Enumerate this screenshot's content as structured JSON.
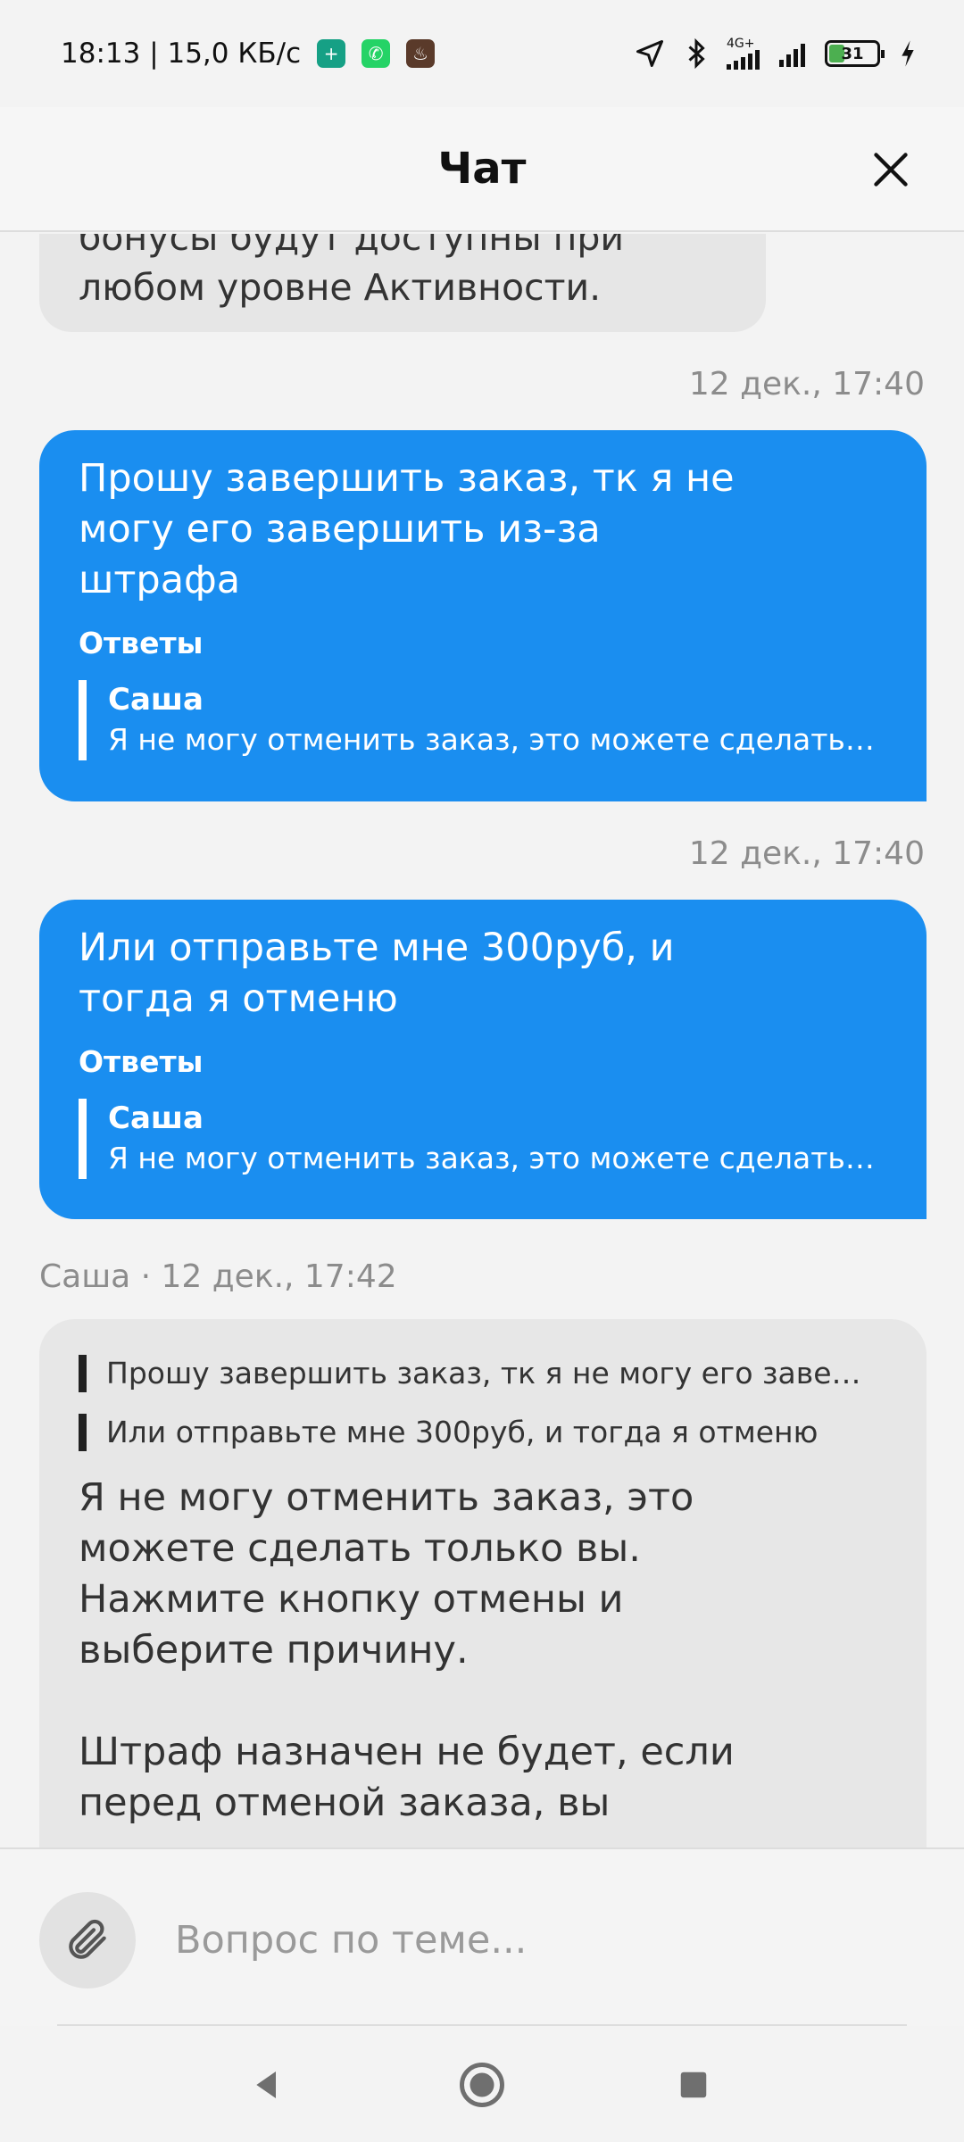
{
  "status_bar": {
    "time_speed": "18:13 | 15,0 КБ/с",
    "network_label": "4G+",
    "battery_level": "31"
  },
  "header": {
    "title": "Чат"
  },
  "chat": {
    "partial_message": {
      "line1": "бонусы будут доступны при",
      "line2": "любом уровне Активности."
    },
    "messages": [
      {
        "timestamp": "12 дек., 17:40",
        "text": "Прошу завершить заказ, тк я не могу его завершить из-за штрафа",
        "answers_label": "Ответы",
        "reply_author": "Саша",
        "reply_text": "Я не могу отменить заказ, это можете сделать…"
      },
      {
        "timestamp": "12 дек., 17:40",
        "text": "Или отправьте мне 300руб, и тогда я отменю",
        "answers_label": "Ответы",
        "reply_author": "Саша",
        "reply_text": "Я не могу отменить заказ, это можете сделать…"
      }
    ],
    "incoming": {
      "meta": "Саша · 12 дек., 17:42",
      "quotes": [
        "Прошу завершить заказ, тк я не могу его заве…",
        "Или отправьте мне 300руб, и тогда я отменю"
      ],
      "text": "Я не могу отменить заказ, это можете сделать только вы. Нажмите кнопку отмены и выберите причину.\n\nШтраф назначен не будет, если перед отменой заказа, вы"
    }
  },
  "composer": {
    "placeholder": "Вопрос по теме..."
  },
  "colors": {
    "outgoing_bubble": "#1a8ef0",
    "incoming_bubble": "#e7e7e7"
  }
}
